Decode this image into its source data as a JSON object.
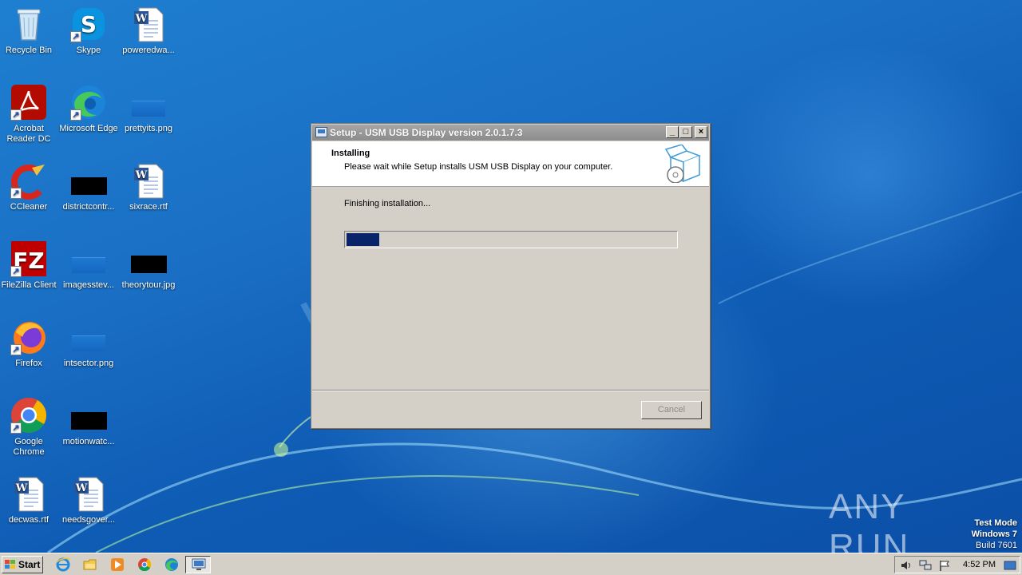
{
  "desktop": {
    "icons": [
      {
        "label": "Recycle Bin",
        "icon": "recycle-bin-icon"
      },
      {
        "label": "Skype",
        "icon": "skype-icon"
      },
      {
        "label": "poweredwa...",
        "icon": "word-document-icon"
      },
      {
        "label": "Acrobat Reader DC",
        "label_line1": "Acrobat",
        "label_line2": "Reader DC",
        "icon": "acrobat-reader-icon"
      },
      {
        "label": "Microsoft Edge",
        "icon": "edge-icon"
      },
      {
        "label": "prettyits.png",
        "icon": "image-file-icon"
      },
      {
        "label": "CCleaner",
        "icon": "ccleaner-icon"
      },
      {
        "label": "districtcontr...",
        "icon": "image-file-icon"
      },
      {
        "label": "sixrace.rtf",
        "icon": "word-document-icon"
      },
      {
        "label": "FileZilla Client",
        "icon": "filezilla-icon"
      },
      {
        "label": "imagesstev...",
        "icon": "image-file-icon"
      },
      {
        "label": "theorytour.jpg",
        "icon": "image-file-icon"
      },
      {
        "label": "Firefox",
        "icon": "firefox-icon"
      },
      {
        "label": "intsector.png",
        "icon": "image-file-icon"
      },
      {
        "label": "Google Chrome",
        "label_line1": "Google",
        "label_line2": "Chrome",
        "icon": "chrome-icon"
      },
      {
        "label": "motionwatc...",
        "icon": "image-file-icon"
      },
      {
        "label": "decwas.rtf",
        "icon": "word-document-icon"
      },
      {
        "label": "needsgover...",
        "icon": "word-document-icon"
      }
    ]
  },
  "dialog": {
    "title": "Setup - USM USB Display version 2.0.1.7.3",
    "header_title": "Installing",
    "header_subtitle": "Please wait while Setup installs USM USB Display on your computer.",
    "status": "Finishing installation...",
    "progress_percent": 10,
    "cancel_label": "Cancel",
    "buttons": {
      "minimize": "_",
      "maximize": "□",
      "close": "×"
    }
  },
  "watermark": {
    "text": "ANY RUN",
    "line1": "Test Mode",
    "line2": "Windows 7",
    "line3": "Build 7601"
  },
  "taskbar": {
    "start_label": "Start",
    "clock": "4:52 PM",
    "pinned": [
      "internet-explorer-icon",
      "explorer-folder-icon",
      "media-player-icon",
      "chrome-icon",
      "edge-icon"
    ]
  },
  "colors": {
    "progress_fill": "#0a246a",
    "dialog_face": "#d4d0c8",
    "desktop_blue": "#1a6fc4"
  }
}
